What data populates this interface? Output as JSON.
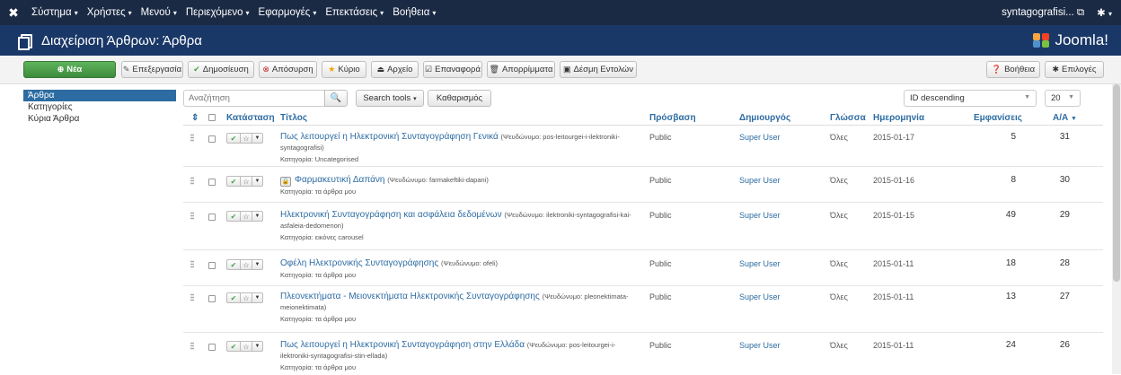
{
  "topbar": {
    "menus": [
      {
        "label": "Σύστημα",
        "name": "menu-system"
      },
      {
        "label": "Χρήστες",
        "name": "menu-users"
      },
      {
        "label": "Μενού",
        "name": "menu-menus"
      },
      {
        "label": "Περιεχόμενο",
        "name": "menu-content"
      },
      {
        "label": "Εφαρμογές",
        "name": "menu-components"
      },
      {
        "label": "Επεκτάσεις",
        "name": "menu-extensions"
      },
      {
        "label": "Βοήθεια",
        "name": "menu-help"
      }
    ],
    "site_name": "syntagografisi...",
    "settings_icon": "gear-icon"
  },
  "header": {
    "title": "Διαχείριση Άρθρων: Άρθρα",
    "brand": "Joomla!",
    "brand_colors": [
      "#f9a541",
      "#f44321",
      "#5091cd",
      "#7ac143"
    ]
  },
  "toolbar": {
    "new_label": "Νέα",
    "edit_label": "Επεξεργασία",
    "publish_label": "Δημοσίευση",
    "unpublish_label": "Απόσυρση",
    "featured_label": "Κύριο",
    "archive_label": "Αρχείο",
    "checkin_label": "Επαναφορά",
    "trash_label": "Απορρίμματα",
    "batch_label": "Δέσμη Εντολών",
    "help_label": "Βοήθεια",
    "options_label": "Επιλογές"
  },
  "sidebar": {
    "items": [
      {
        "label": "Άρθρα",
        "active": true
      },
      {
        "label": "Κατηγορίες",
        "active": false
      },
      {
        "label": "Κύρια Άρθρα",
        "active": false
      }
    ]
  },
  "filters": {
    "search_placeholder": "Αναζήτηση",
    "search_tools_label": "Search tools",
    "clear_label": "Καθαρισμός",
    "ordering_value": "ID descending",
    "limit_value": "20"
  },
  "table": {
    "columns": {
      "status": "Κατάσταση",
      "title": "Τίτλος",
      "access": "Πρόσβαση",
      "author": "Δημιουργός",
      "language": "Γλώσσα",
      "date": "Ημερομηνία",
      "hits": "Εμφανίσεις",
      "id": "Α/Α"
    },
    "rows": [
      {
        "title": "Πως λειτουργεί η Ηλεκτρονική Συνταγογράφηση Γενικά",
        "alias": "(Ψευδώνυμο: pos-leitourgei-i-ilektroniki-syntagografisi)",
        "category": "Κατηγορία: Uncategorised",
        "locked": false,
        "access": "Public",
        "author": "Super User",
        "language": "Όλες",
        "date": "2015-01-17",
        "hits": "5",
        "id": "31"
      },
      {
        "title": "Φαρμακευτική Δαπάνη",
        "alias": "(Ψευδώνυμο: farmakeftiki-dapani)",
        "category": "Κατηγορία: τα άρθρα μου",
        "locked": true,
        "access": "Public",
        "author": "Super User",
        "language": "Όλες",
        "date": "2015-01-16",
        "hits": "8",
        "id": "30"
      },
      {
        "title": "Ηλεκτρονική Συνταγογράφηση και ασφάλεια δεδομένων",
        "alias": "(Ψευδώνυμο: ilektroniki-syntagografisi-kai-asfaleia-dedomenon)",
        "category": "Κατηγορία: εικόνες carousel",
        "locked": false,
        "access": "Public",
        "author": "Super User",
        "language": "Όλες",
        "date": "2015-01-15",
        "hits": "49",
        "id": "29"
      },
      {
        "title": "Οφέλη Ηλεκτρονικής Συνταγογράφησης",
        "alias": "(Ψευδώνυμο: ofeli)",
        "category": "Κατηγορία: τα άρθρα μου",
        "locked": false,
        "access": "Public",
        "author": "Super User",
        "language": "Όλες",
        "date": "2015-01-11",
        "hits": "18",
        "id": "28"
      },
      {
        "title": "Πλεονεκτήματα - Μειονεκτήματα Ηλεκτρονικής Συνταγογράφησης",
        "alias": "(Ψευδώνυμο: pleonektimata-meionektimata)",
        "category": "Κατηγορία: τα άρθρα μου",
        "locked": false,
        "access": "Public",
        "author": "Super User",
        "language": "Όλες",
        "date": "2015-01-11",
        "hits": "13",
        "id": "27"
      },
      {
        "title": "Πως λειτουργεί η Ηλεκτρονική Συνταγογράφηση στην Ελλάδα",
        "alias": "(Ψευδώνυμο: pos-leitourgei-i-ilektroniki-syntagografisi-stin-ellada)",
        "category": "Κατηγορία: τα άρθρα μου",
        "locked": false,
        "access": "Public",
        "author": "Super User",
        "language": "Όλες",
        "date": "2015-01-11",
        "hits": "24",
        "id": "26"
      }
    ]
  }
}
